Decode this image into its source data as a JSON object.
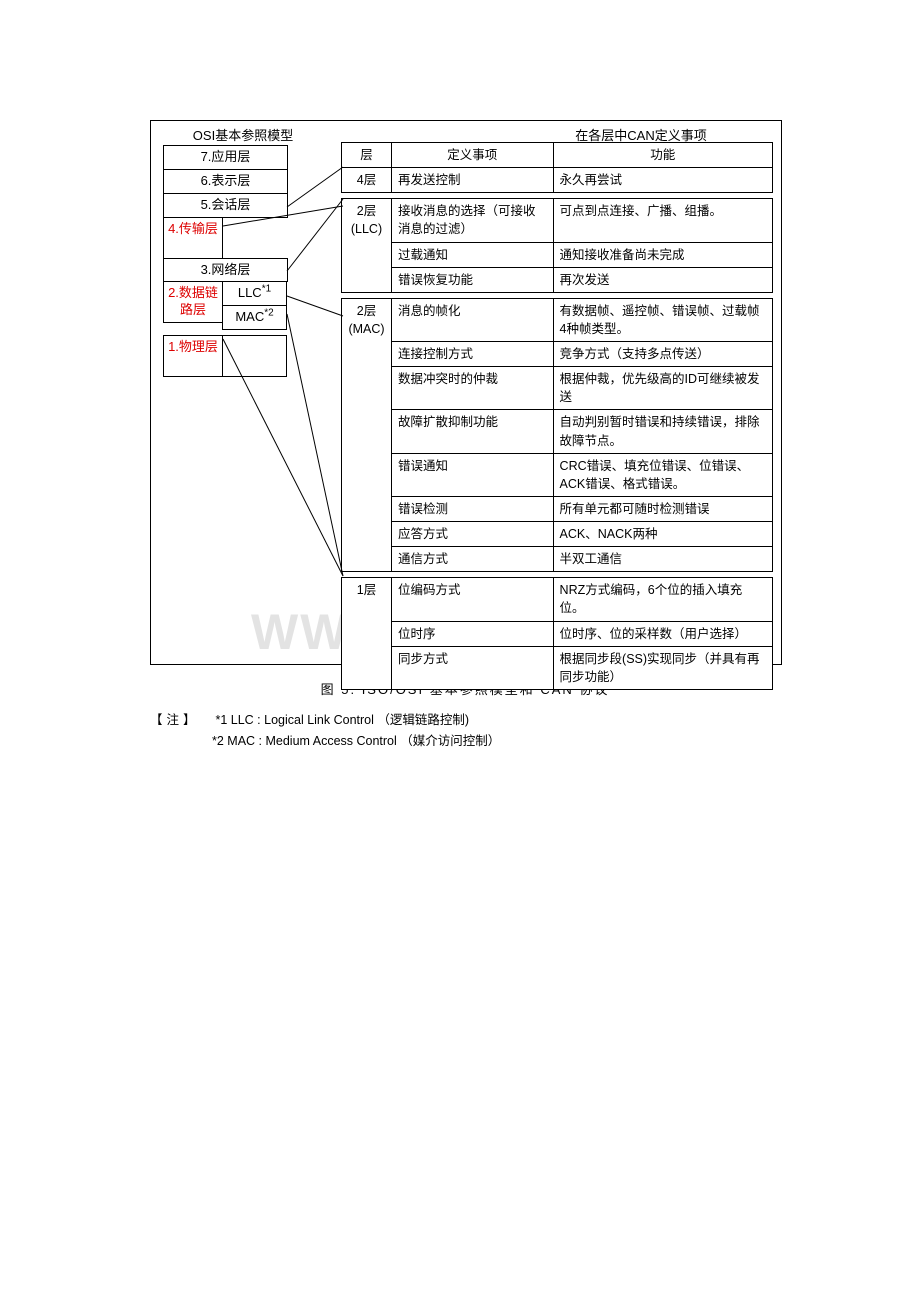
{
  "osi": {
    "title": "OSI基本参照模型",
    "layers": {
      "l7": "7.应用层",
      "l6": "6.表示层",
      "l5": "5.会话层",
      "l4": "4.传输层",
      "l3": "3.网络层",
      "l2": "2.数据链路层",
      "l2_llc": "LLC",
      "l2_llc_sup": "*1",
      "l2_mac": "MAC",
      "l2_mac_sup": "*2",
      "l1": "1.物理层"
    }
  },
  "can": {
    "title": "在各层中CAN定义事项",
    "headers": {
      "layer": "层",
      "item": "定义事项",
      "func": "功能"
    },
    "groups": [
      {
        "layer": "4层",
        "rows": [
          {
            "item": "再发送控制",
            "func": "永久再尝试"
          }
        ]
      },
      {
        "layer": "2层(LLC)",
        "rows": [
          {
            "item": "接收消息的选择（可接收消息的过滤）",
            "func": "可点到点连接、广播、组播。"
          },
          {
            "item": "过载通知",
            "func": "通知接收准备尚未完成"
          },
          {
            "item": "错误恢复功能",
            "func": "再次发送"
          }
        ]
      },
      {
        "layer": "2层(MAC)",
        "rows": [
          {
            "item": "消息的帧化",
            "func": "有数据帧、遥控帧、错误帧、过载帧4种帧类型。"
          },
          {
            "item": "连接控制方式",
            "func": "竞争方式（支持多点传送）"
          },
          {
            "item": "数据冲突时的仲裁",
            "func": "根据仲裁，优先级高的ID可继续被发送"
          },
          {
            "item": "故障扩散抑制功能",
            "func": "自动判别暂时错误和持续错误，排除故障节点。"
          },
          {
            "item": "错误通知",
            "func": "CRC错误、填充位错误、位错误、ACK错误、格式错误。"
          },
          {
            "item": "错误检测",
            "func": "所有单元都可随时检测错误"
          },
          {
            "item": "应答方式",
            "func": "ACK、NACK两种"
          },
          {
            "item": "通信方式",
            "func": "半双工通信"
          }
        ]
      },
      {
        "layer": "1层",
        "rows": [
          {
            "item": "位编码方式",
            "func": "NRZ方式编码，6个位的插入填充位。"
          },
          {
            "item": "位时序",
            "func": "位时序、位的采样数（用户选择）"
          },
          {
            "item": "同步方式",
            "func": "根据同步段(SS)实现同步（并具有再同步功能）"
          }
        ]
      }
    ]
  },
  "caption": "图 5.  ISO/OSI 基本参照模型和 CAN 协议",
  "notes": {
    "label": "【注】",
    "n1": "*1   LLC : Logical Link Control （逻辑链路控制)",
    "n2": "*2   MAC : Medium Access Control （媒介访问控制）"
  },
  "watermark": "WWW."
}
